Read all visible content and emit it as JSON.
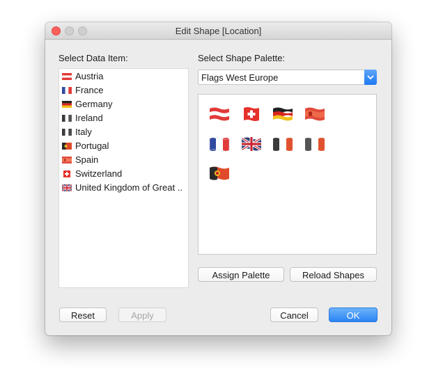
{
  "window": {
    "title": "Edit Shape [Location]"
  },
  "left": {
    "label": "Select Data Item:",
    "items": [
      {
        "label": "Austria",
        "icon": "flag-austria-icon"
      },
      {
        "label": "France",
        "icon": "flag-france-icon"
      },
      {
        "label": "Germany",
        "icon": "flag-germany-icon"
      },
      {
        "label": "Ireland",
        "icon": "flag-ireland-icon"
      },
      {
        "label": "Italy",
        "icon": "flag-italy-icon"
      },
      {
        "label": "Portugal",
        "icon": "flag-portugal-icon"
      },
      {
        "label": "Spain",
        "icon": "flag-spain-icon"
      },
      {
        "label": "Switzerland",
        "icon": "flag-switzerland-icon"
      },
      {
        "label": "United Kingdom of Great ..",
        "icon": "flag-uk-icon"
      }
    ]
  },
  "right": {
    "label": "Select Shape Palette:",
    "palette_value": "Flags West Europe",
    "shapes": [
      "flag-austria-icon",
      "flag-switzerland-icon",
      "flag-germany-icon",
      "flag-spain-icon",
      "flag-france-icon",
      "flag-uk-icon",
      "flag-italy-icon",
      "flag-ireland-icon",
      "flag-portugal-icon"
    ],
    "assign_label": "Assign Palette",
    "reload_label": "Reload Shapes"
  },
  "footer": {
    "reset_label": "Reset",
    "apply_label": "Apply",
    "cancel_label": "Cancel",
    "ok_label": "OK"
  },
  "colors": {
    "accent": "#2b84f4",
    "close": "#fc605c"
  }
}
